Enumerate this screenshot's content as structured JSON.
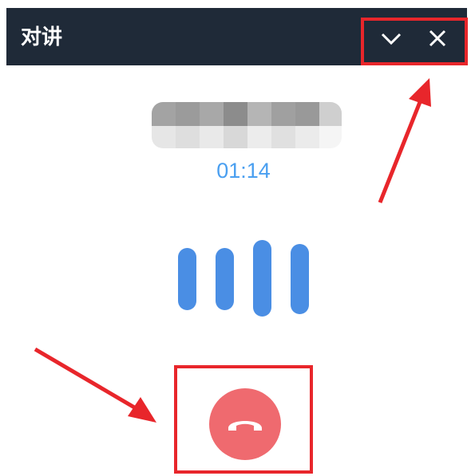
{
  "window": {
    "title": "对讲",
    "minimize_icon": "chevron-down-icon",
    "close_icon": "close-icon"
  },
  "call": {
    "duration": "01:14",
    "caller_name_obscured": true,
    "voice_level_icon": "audio-level-bars",
    "hangup_icon": "phone-hangup-icon"
  },
  "colors": {
    "titlebar": "#1f2a38",
    "timer": "#4a9ff0",
    "audio_bars": "#4a8ee4",
    "hangup_button": "#ef6a6f",
    "annotation": "#e8262b"
  }
}
